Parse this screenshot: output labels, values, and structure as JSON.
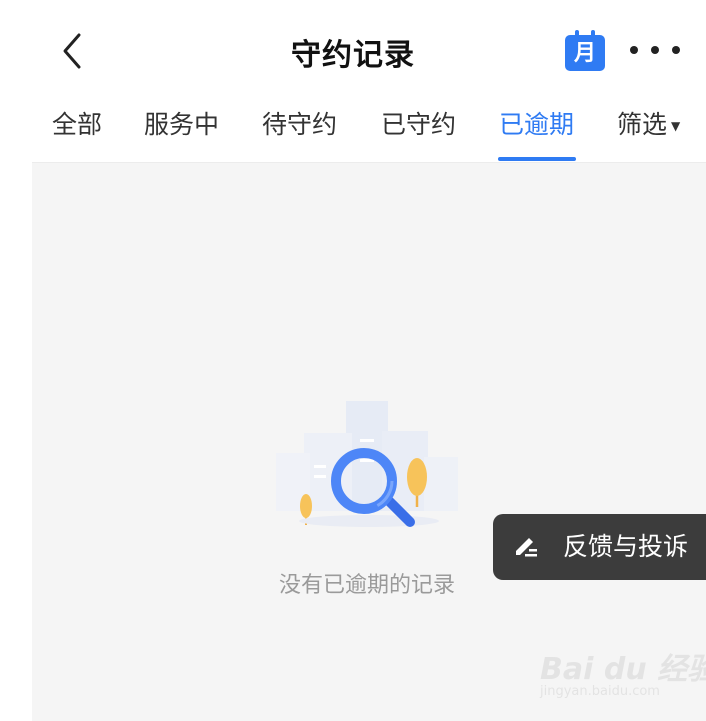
{
  "header": {
    "title": "守约记录",
    "calendar_label": "月",
    "back_icon": "chevron-left-icon",
    "more_icon": "more-horizontal-icon"
  },
  "tabs": [
    {
      "label": "全部",
      "active": false
    },
    {
      "label": "服务中",
      "active": false
    },
    {
      "label": "待守约",
      "active": false
    },
    {
      "label": "已守约",
      "active": false
    },
    {
      "label": "已逾期",
      "active": true
    },
    {
      "label": "筛选",
      "active": false,
      "dropdown": true
    }
  ],
  "empty_state": {
    "message": "没有已逾期的记录",
    "icon": "magnifier-illustration"
  },
  "feedback": {
    "label": "反馈与投诉",
    "icon": "edit-pen-icon"
  },
  "watermark": {
    "brand": "Bai du 经验",
    "url": "jingyan.baidu.com"
  },
  "colors": {
    "accent": "#2f7bf3",
    "background": "#f5f5f5",
    "feedback_bg": "#3c3c3c",
    "muted_text": "#9a9a9a"
  }
}
